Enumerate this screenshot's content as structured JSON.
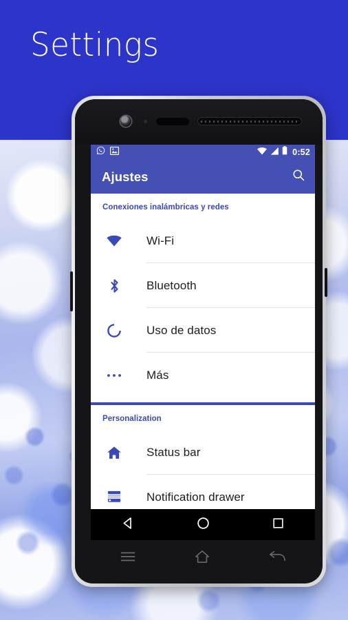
{
  "hero": {
    "title": "Settings",
    "background_color": "#2d34c9"
  },
  "theme": {
    "accent": "#3b49b8",
    "toolbar": "#4450b4",
    "statusbar": "#4450b4",
    "screen_background": "#ffffff",
    "text_primary": "#1d1d1d",
    "divider": "#e3e3e5"
  },
  "device": {
    "bezel_color": "#d9dadc",
    "frame_color": "#151518",
    "components": {
      "front_camera": "front-camera",
      "proximity_sensor": "proximity-sensor",
      "notification_led": "notification-led",
      "earpiece_speaker": "earpiece-speaker"
    }
  },
  "statusbar": {
    "left_icons": [
      {
        "name": "whatsapp-icon",
        "label": "WhatsApp"
      },
      {
        "name": "image-icon",
        "label": "Image"
      }
    ],
    "right_icons": [
      {
        "name": "wifi-icon",
        "label": "Wi-Fi signal"
      },
      {
        "name": "cellular-signal-icon",
        "label": "Cellular signal"
      },
      {
        "name": "battery-icon",
        "label": "Battery"
      }
    ],
    "time": "0:52"
  },
  "toolbar": {
    "title": "Ajustes",
    "search_label": "Buscar",
    "search_icon": "search-icon"
  },
  "list": {
    "sections": [
      {
        "header": "Conexiones inalámbricas y redes",
        "items": [
          {
            "label": "Wi-Fi",
            "icon": "wifi-icon"
          },
          {
            "label": "Bluetooth",
            "icon": "bluetooth-icon"
          },
          {
            "label": "Uso de datos",
            "icon": "data-usage-icon"
          },
          {
            "label": "Más",
            "icon": "more-horizontal-icon"
          }
        ]
      },
      {
        "header": "Personalization",
        "items": [
          {
            "label": "Status bar",
            "icon": "home-icon"
          },
          {
            "label": "Notification drawer",
            "icon": "notification-drawer-icon"
          }
        ]
      }
    ]
  },
  "navbar": {
    "buttons": [
      {
        "name": "back-button",
        "icon": "back-triangle-icon",
        "label": "Back"
      },
      {
        "name": "home-button",
        "icon": "home-circle-icon",
        "label": "Home"
      },
      {
        "name": "recents-button",
        "icon": "recents-square-icon",
        "label": "Recents"
      }
    ]
  },
  "capacitive_keys": [
    {
      "name": "menu-key",
      "icon": "menu-hamburger-icon",
      "label": "Menu"
    },
    {
      "name": "home-key",
      "icon": "home-outline-icon",
      "label": "Home"
    },
    {
      "name": "back-key",
      "icon": "back-arrow-icon",
      "label": "Back"
    }
  ]
}
